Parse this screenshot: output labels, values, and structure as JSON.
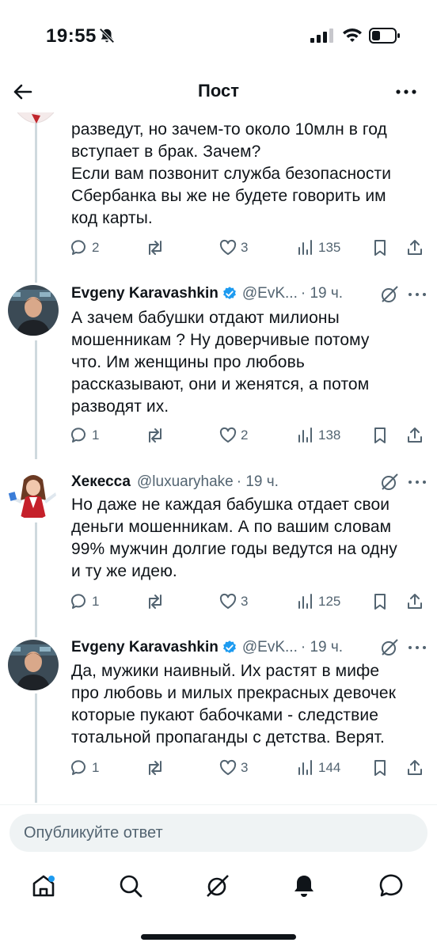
{
  "status": {
    "time": "19:55"
  },
  "header": {
    "title": "Пост"
  },
  "tweets": [
    {
      "text_lines": [
        "разведут, но зачем-то около 10млн в год",
        "вступает в брак. Зачем?",
        "Если вам позвонит служба безопасности",
        "Сбербанка вы же не будете говорить им",
        "код карты."
      ],
      "replies": "2",
      "likes": "3",
      "views": "135"
    },
    {
      "author": "Evgeny Karavashkin",
      "verified": true,
      "handle": "@EvK...",
      "time": "· 19 ч.",
      "text_lines": [
        "А зачем бабушки отдают милионы",
        "мошенникам ? Ну доверчивые потому",
        "что. Им женщины про любовь",
        "рассказывают, они и женятся, а потом",
        "разводят их."
      ],
      "replies": "1",
      "likes": "2",
      "views": "138"
    },
    {
      "author": "Хекесса",
      "verified": false,
      "handle": "@luxuaryhake",
      "time": "· 19 ч.",
      "text_lines": [
        "Но даже не каждая бабушка отдает свои",
        "деньги мошенникам. А по вашим словам",
        "99% мужчин долгие годы ведутся на одну",
        "и ту же идею."
      ],
      "replies": "1",
      "likes": "3",
      "views": "125"
    },
    {
      "author": "Evgeny Karavashkin",
      "verified": true,
      "handle": "@EvK...",
      "time": "· 19 ч.",
      "text_lines": [
        "Да, мужики наивный. Их растят в мифе",
        "про любовь и милых прекрасных девочек",
        "которые пукают бабочками - следствие",
        "тотальной пропаганды с детства. Верят."
      ],
      "replies": "1",
      "likes": "3",
      "views": "144"
    }
  ],
  "reply": {
    "placeholder": "Опубликуйте ответ"
  },
  "colors": {
    "text": "#0f1419",
    "muted": "#536471",
    "verified": "#1d9bf0",
    "thread": "#cfd9de",
    "input_bg": "#eff3f4"
  },
  "icons": [
    "bell-off-icon",
    "signal-icon",
    "wifi-icon",
    "battery-icon",
    "back-arrow-icon",
    "more-icon",
    "reply-icon",
    "retweet-icon",
    "like-icon",
    "views-icon",
    "bookmark-icon",
    "share-icon",
    "grok-icon",
    "verified-icon",
    "home-icon",
    "search-icon",
    "grok-tab-icon",
    "notifications-icon",
    "messages-icon"
  ]
}
